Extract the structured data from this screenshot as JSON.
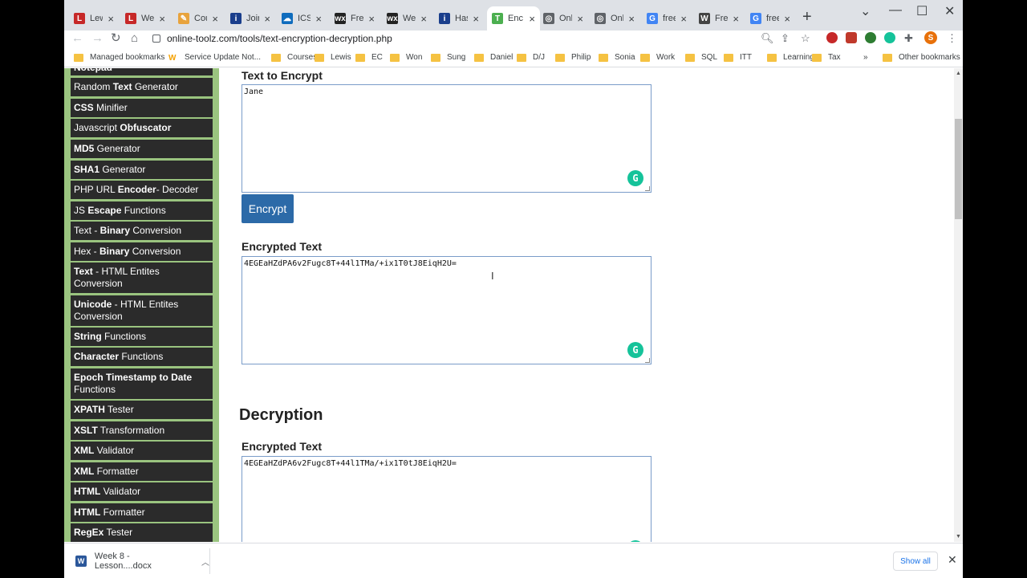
{
  "browser": {
    "tabs": [
      {
        "title": "Lewis",
        "favicon": "L",
        "color": "#c62828"
      },
      {
        "title": "Welcome",
        "favicon": "L",
        "color": "#c62828"
      },
      {
        "title": "Course",
        "favicon": "✎",
        "color": "#e8a33d"
      },
      {
        "title": "Join",
        "favicon": "i",
        "color": "#1a3e8c"
      },
      {
        "title": "ICS",
        "favicon": "☁",
        "color": "#0f6cbd"
      },
      {
        "title": "Free",
        "favicon": "wx",
        "color": "#222222"
      },
      {
        "title": "Welcome",
        "favicon": "wx",
        "color": "#222222"
      },
      {
        "title": "Has",
        "favicon": "i",
        "color": "#1a3e8c"
      },
      {
        "title": "Enc",
        "favicon": "T",
        "color": "#4caf50"
      },
      {
        "title": "Onl",
        "favicon": "◎",
        "color": "#5f6368"
      },
      {
        "title": "Onl",
        "favicon": "◎",
        "color": "#5f6368"
      },
      {
        "title": "free",
        "favicon": "G",
        "color": "#4285f4"
      },
      {
        "title": "Free",
        "favicon": "W",
        "color": "#444444"
      },
      {
        "title": "free",
        "favicon": "G",
        "color": "#4285f4"
      }
    ],
    "active_tab": 8,
    "url": "online-toolz.com/tools/text-encryption-decryption.php",
    "bookmarks": [
      "Managed bookmarks",
      "Service Update Not...",
      "Courses",
      "Lewis",
      "EC",
      "Won",
      "Sung",
      "Daniel",
      "D/J",
      "Philip",
      "Sonia",
      "Work",
      "SQL",
      "ITT",
      "Learning",
      "Tax"
    ],
    "other_bookmarks": "Other bookmarks",
    "overflow": "»",
    "profile_initial": "S"
  },
  "sidebar": {
    "items": [
      {
        "pre": "",
        "bold": "Notepad",
        "post": ""
      },
      {
        "pre": "Random ",
        "bold": "Text",
        "post": " Generator"
      },
      {
        "pre": "",
        "bold": "CSS",
        "post": " Minifier"
      },
      {
        "pre": "Javascript ",
        "bold": "Obfuscator",
        "post": ""
      },
      {
        "pre": "",
        "bold": "MD5",
        "post": " Generator"
      },
      {
        "pre": "",
        "bold": "SHA1",
        "post": " Generator"
      },
      {
        "pre": "PHP URL ",
        "bold": "Encoder",
        "post": "- Decoder"
      },
      {
        "pre": "JS ",
        "bold": "Escape",
        "post": " Functions"
      },
      {
        "pre": "Text - ",
        "bold": "Binary",
        "post": " Conversion"
      },
      {
        "pre": "Hex - ",
        "bold": "Binary",
        "post": " Conversion"
      },
      {
        "pre": "",
        "bold": "Text",
        "post": " - HTML Entites Conversion"
      },
      {
        "pre": "",
        "bold": "Unicode",
        "post": " - HTML Entites Conversion"
      },
      {
        "pre": "",
        "bold": "String",
        "post": " Functions"
      },
      {
        "pre": "",
        "bold": "Character",
        "post": " Functions"
      },
      {
        "pre": "",
        "bold": "Epoch Timestamp to Date",
        "post": " Functions"
      },
      {
        "pre": "",
        "bold": "XPATH",
        "post": " Tester"
      },
      {
        "pre": "",
        "bold": "XSLT",
        "post": " Transformation"
      },
      {
        "pre": "",
        "bold": "XML",
        "post": " Validator"
      },
      {
        "pre": "",
        "bold": "XML",
        "post": " Formatter"
      },
      {
        "pre": "",
        "bold": "HTML",
        "post": " Validator"
      },
      {
        "pre": "",
        "bold": "HTML",
        "post": " Formatter"
      },
      {
        "pre": "",
        "bold": "RegEx",
        "post": " Tester"
      }
    ]
  },
  "encryption": {
    "text_label": "Text to Encrypt",
    "text_value": "Jane",
    "button_label": "Encrypt",
    "result_label": "Encrypted Text",
    "result_value": "4EGEaHZdPA6v2Fugc8T+44l1TMa/+ix1T0tJ8EiqH2U="
  },
  "decryption": {
    "heading": "Decryption",
    "input_label": "Encrypted Text",
    "input_value": "4EGEaHZdPA6v2Fugc8T+44l1TMa/+ix1T0tJ8EiqH2U="
  },
  "downloads": {
    "file_name": "Week 8 - Lesson....docx",
    "show_all": "Show all"
  }
}
